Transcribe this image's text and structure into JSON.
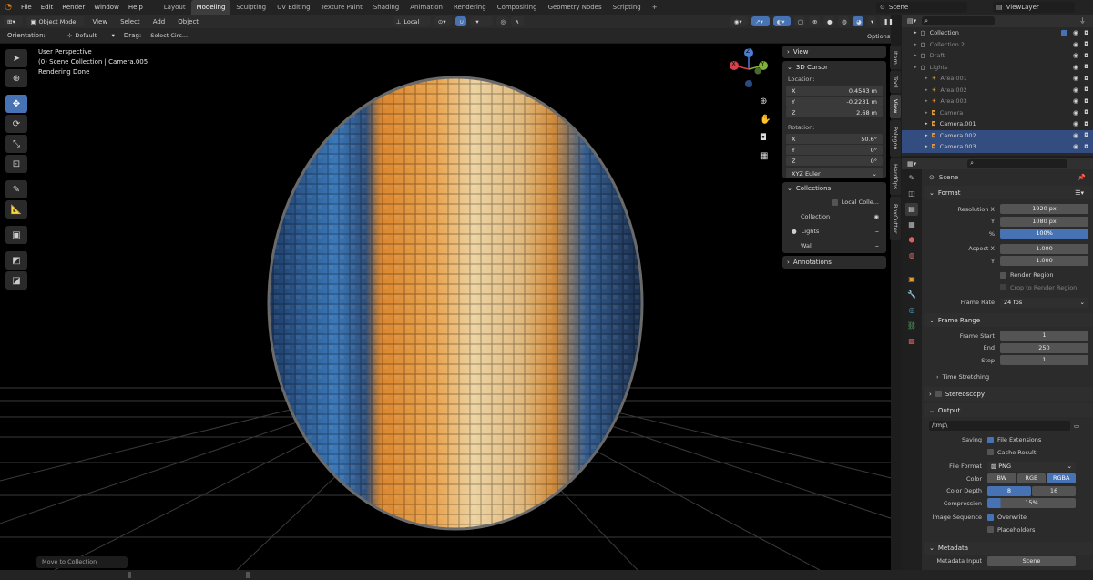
{
  "topbar": {
    "menus": [
      "File",
      "Edit",
      "Render",
      "Window",
      "Help"
    ],
    "workspaces": [
      "Layout",
      "Modeling",
      "Sculpting",
      "UV Editing",
      "Texture Paint",
      "Shading",
      "Animation",
      "Rendering",
      "Compositing",
      "Geometry Nodes",
      "Scripting"
    ],
    "active_workspace": "Modeling",
    "add_tab": "+",
    "scene": "Scene",
    "view_layer": "ViewLayer"
  },
  "vp_header": {
    "mode": "Object Mode",
    "menus": [
      "View",
      "Select",
      "Add",
      "Object"
    ],
    "transform": "Local"
  },
  "tool_header": {
    "orientation_label": "Orientation:",
    "orientation_value": "Default",
    "drag_label": "Drag:",
    "drag_value": "Select Circ...",
    "options": "Options"
  },
  "viewport": {
    "line1": "User Perspective",
    "line2": "(0) Scene Collection | Camera.005",
    "line3": "Rendering Done",
    "bottom_popup": "Move to Collection",
    "gizmo": {
      "z": "Z",
      "y": "Y",
      "x": "X"
    }
  },
  "npanel": {
    "view_header": "View",
    "cursor_header": "3D Cursor",
    "location_label": "Location:",
    "loc": [
      {
        "axis": "X",
        "value": "0.4543 m"
      },
      {
        "axis": "Y",
        "value": "-0.2231 m"
      },
      {
        "axis": "Z",
        "value": "2.68 m"
      }
    ],
    "rotation_label": "Rotation:",
    "rot": [
      {
        "axis": "X",
        "value": "50.6°"
      },
      {
        "axis": "Y",
        "value": "0°"
      },
      {
        "axis": "Z",
        "value": "0°"
      }
    ],
    "rot_mode": "XYZ Euler",
    "collections_header": "Collections",
    "local_collections": "Local Colle...",
    "collections": [
      "Collection",
      "Lights",
      "Wall"
    ],
    "annotations_header": "Annotations"
  },
  "vtabs": [
    "Item",
    "Tool",
    "View",
    "Polygon",
    "HardOps",
    "BoxCutter"
  ],
  "outliner": {
    "rows": [
      {
        "name": "Collection",
        "indent": 1,
        "sel": false,
        "dim": false
      },
      {
        "name": "Collection 2",
        "indent": 1,
        "sel": false,
        "dim": true
      },
      {
        "name": "Draft",
        "indent": 1,
        "sel": false,
        "dim": true
      },
      {
        "name": "Lights",
        "indent": 1,
        "sel": false,
        "dim": true
      },
      {
        "name": "Area.001",
        "indent": 2,
        "sel": false,
        "dim": true
      },
      {
        "name": "Area.002",
        "indent": 2,
        "sel": false,
        "dim": true
      },
      {
        "name": "Area.003",
        "indent": 2,
        "sel": false,
        "dim": true
      },
      {
        "name": "Camera",
        "indent": 2,
        "sel": false,
        "dim": true
      },
      {
        "name": "Camera.001",
        "indent": 2,
        "sel": false,
        "dim": false
      },
      {
        "name": "Camera.002",
        "indent": 2,
        "sel": true,
        "dim": false
      },
      {
        "name": "Camera.003",
        "indent": 2,
        "sel": true,
        "dim": false
      }
    ]
  },
  "props": {
    "title": "Scene",
    "format_header": "Format",
    "res_x_label": "Resolution X",
    "res_x": "1920 px",
    "res_y_label": "Y",
    "res_y": "1080 px",
    "res_pct_label": "%",
    "res_pct": "100%",
    "aspect_x_label": "Aspect X",
    "aspect_x": "1.000",
    "aspect_y_label": "Y",
    "aspect_y": "1.000",
    "render_region": "Render Region",
    "crop_region": "Crop to Render Region",
    "frame_rate_label": "Frame Rate",
    "frame_rate": "24 fps",
    "frame_range_header": "Frame Range",
    "frame_start_label": "Frame Start",
    "frame_start": "1",
    "end_label": "End",
    "end": "250",
    "step_label": "Step",
    "step": "1",
    "time_stretching": "Time Stretching",
    "stereoscopy": "Stereoscopy",
    "output_header": "Output",
    "output_path": "/tmp\\",
    "saving_label": "Saving",
    "file_ext": "File Extensions",
    "cache_result": "Cache Result",
    "file_format_label": "File Format",
    "file_format": "PNG",
    "color_label": "Color",
    "color_opts": [
      "BW",
      "RGB",
      "RGBA"
    ],
    "depth_label": "Color Depth",
    "depth_opts": [
      "8",
      "16"
    ],
    "compression_label": "Compression",
    "compression": "15%",
    "img_seq_label": "Image Sequence",
    "overwrite": "Overwrite",
    "placeholders": "Placeholders",
    "metadata_header": "Metadata",
    "metadata_sub": "Metadata Input",
    "metadata_val": "Scene"
  }
}
